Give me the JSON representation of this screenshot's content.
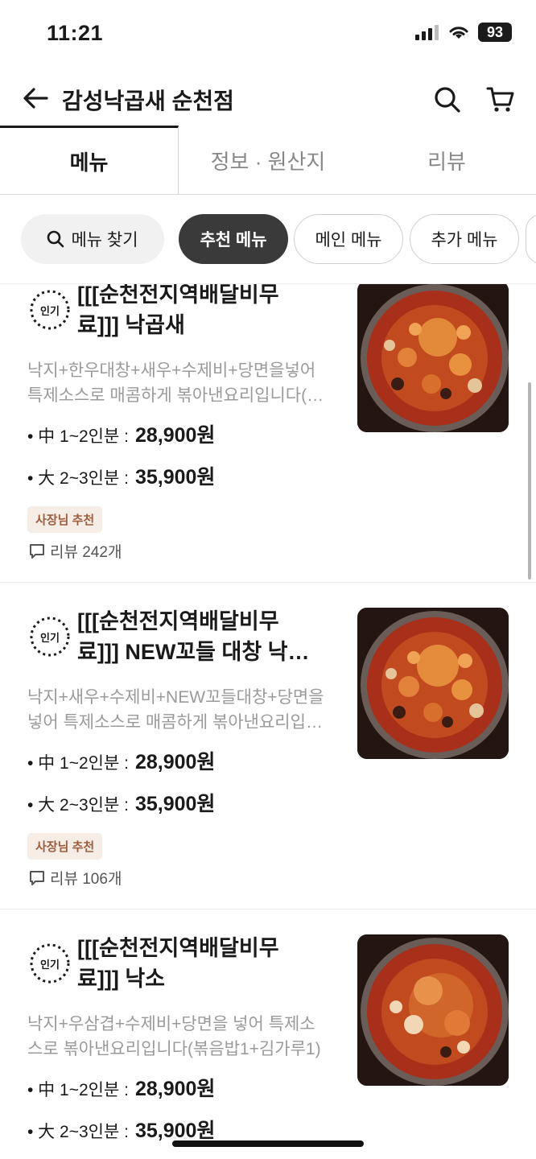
{
  "status": {
    "time": "11:21",
    "battery": "93"
  },
  "header": {
    "title": "감성낙곱새 순천점"
  },
  "tabs": [
    {
      "label": "메뉴"
    },
    {
      "label": "정보 · 원산지"
    },
    {
      "label": "리뷰"
    }
  ],
  "chips": {
    "search": "메뉴 찾기",
    "recommend": "추천 메뉴",
    "main": "메인 메뉴",
    "extra": "추가 메뉴"
  },
  "menu_items": [
    {
      "badge": "인기",
      "title_line1": "[[[순천전지역배달비무",
      "title_line2": "료]]] 낙곱새",
      "desc_line1": "낙지+한우대창+새우+수제비+당면을넣어",
      "desc_line2": "특제소스로 매콤하게 볶아낸요리입니다(…",
      "price_medium_label": "• 中 1~2인분 :",
      "price_medium": "28,900원",
      "price_large_label": "• 大 2~3인분 :",
      "price_large": "35,900원",
      "tag": "사장님 추천",
      "reviews": "리뷰 242개"
    },
    {
      "badge": "인기",
      "title_line1": "[[[순천전지역배달비무",
      "title_line2": "료]]] NEW꼬들 대창 낙…",
      "desc_line1": "낙지+새우+수제비+NEW꼬들대창+당면을",
      "desc_line2": "넣어 특제소스로 매콤하게 볶아낸요리입…",
      "price_medium_label": "• 中 1~2인분 :",
      "price_medium": "28,900원",
      "price_large_label": "• 大 2~3인분 :",
      "price_large": "35,900원",
      "tag": "사장님 추천",
      "reviews": "리뷰 106개"
    },
    {
      "badge": "인기",
      "title_line1": "[[[순천전지역배달비무",
      "title_line2": "료]]] 낙소",
      "desc_line1": "낙지+우삼겹+수제비+당면을 넣어 특제소",
      "desc_line2": "스로 볶아낸요리입니다(볶음밥1+김가루1)",
      "price_medium_label": "• 中 1~2인분 :",
      "price_medium": "28,900원",
      "price_large_label": "• 大 2~3인분 :",
      "price_large": "35,900원"
    }
  ],
  "colors": {
    "accent_dark": "#3a3a3a",
    "tag_bg": "#f6ede7",
    "tag_text": "#9b5e3c"
  }
}
